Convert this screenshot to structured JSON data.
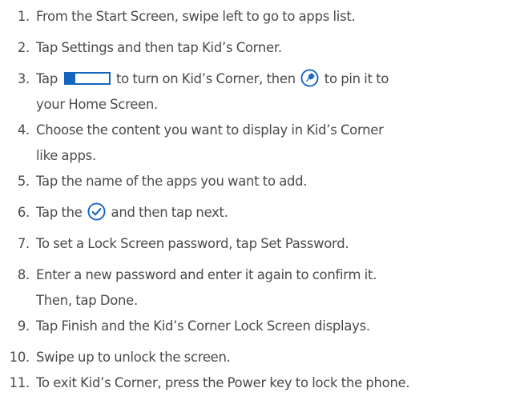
{
  "steps": [
    {
      "num": "1.",
      "text": "From the Start Screen, swipe left to go to apps list."
    },
    {
      "num": "2.",
      "text": "Tap Settings and then tap Kid’s Corner."
    },
    {
      "num": "3.",
      "text_a": "Tap",
      "text_b": "to turn on Kid’s Corner, then",
      "text_c": "to pin it to",
      "text_line2": "your Home Screen."
    },
    {
      "num": "4.",
      "text": "Choose the content you want to display in Kid’s Corner",
      "text_line2": "like apps."
    },
    {
      "num": "5.",
      "text": "Tap the name of the apps you want to add."
    },
    {
      "num": "6.",
      "text_a": "Tap the",
      "text_b": "and then tap next."
    },
    {
      "num": "7.",
      "text": "To set a Lock Screen password, tap Set Password."
    },
    {
      "num": "8.",
      "text": "Enter a new password and enter it again to confirm it.",
      "text_line2": "Then, tap Done."
    },
    {
      "num": "9.",
      "text": "Tap Finish and the Kid’s Corner Lock Screen displays."
    },
    {
      "num": "10.",
      "text": "Swipe up to unlock the screen."
    },
    {
      "num": "11.",
      "text": "To exit Kid’s Corner, press the Power key to lock the phone."
    }
  ],
  "icons": {
    "toggle": "toggle-switch-icon",
    "pin": "pin-icon",
    "check": "check-circle-icon"
  },
  "colors": {
    "text": "#4a4a4a",
    "accent": "#1565c0"
  }
}
